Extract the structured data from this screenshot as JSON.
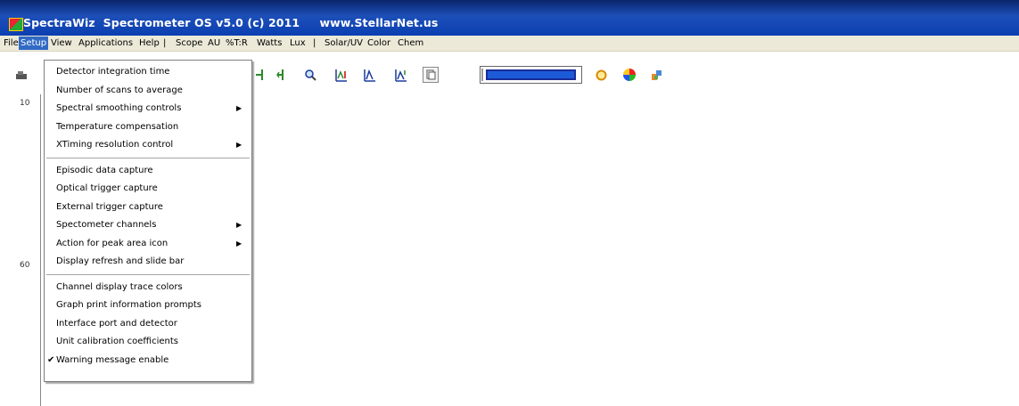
{
  "window": {
    "title": "SpectraWiz  Spectrometer OS v5.0 (c) 2011     www.StellarNet.us"
  },
  "menubar": {
    "items": [
      {
        "label": "File"
      },
      {
        "label": "Setup"
      },
      {
        "label": "View"
      },
      {
        "label": "Applications"
      },
      {
        "label": "Help"
      },
      {
        "label": "|"
      },
      {
        "label": "Scope"
      },
      {
        "label": "AU"
      },
      {
        "label": "%T:R"
      },
      {
        "label": "Watts"
      },
      {
        "label": "Lux"
      },
      {
        "label": "|"
      },
      {
        "label": "Solar/UV"
      },
      {
        "label": "Color"
      },
      {
        "label": "Chem"
      }
    ]
  },
  "toolbar": {
    "icons": [
      "scope-icon",
      "cursor-left-icon",
      "cursor-right-icon",
      "zoom-icon",
      "autoscale-icon",
      "peak-icon",
      "peak-area-icon",
      "copy-icon",
      "color-swatch",
      "circle-icon",
      "color-wheel-icon",
      "paint-icon"
    ],
    "trace_color": "#1c5ad8"
  },
  "yaxis": {
    "ticks": [
      "10",
      "60"
    ]
  },
  "setup_menu": {
    "groups": [
      [
        {
          "label": "Detector integration time",
          "submenu": false,
          "checked": false
        },
        {
          "label": "Number of scans to average",
          "submenu": false,
          "checked": false
        },
        {
          "label": "Spectral smoothing controls",
          "submenu": true,
          "checked": false
        },
        {
          "label": "Temperature compensation",
          "submenu": false,
          "checked": false
        },
        {
          "label": "XTiming resolution control",
          "submenu": true,
          "checked": false
        }
      ],
      [
        {
          "label": "Episodic data capture",
          "submenu": false,
          "checked": false
        },
        {
          "label": "Optical trigger capture",
          "submenu": false,
          "checked": false
        },
        {
          "label": "External trigger capture",
          "submenu": false,
          "checked": false
        },
        {
          "label": "Spectometer channels",
          "submenu": true,
          "checked": false
        },
        {
          "label": "Action for peak area icon",
          "submenu": true,
          "checked": false
        },
        {
          "label": "Display refresh and slide bar",
          "submenu": false,
          "checked": false
        }
      ],
      [
        {
          "label": "Channel display trace colors",
          "submenu": false,
          "checked": false
        },
        {
          "label": "Graph print information prompts",
          "submenu": false,
          "checked": false
        },
        {
          "label": "Interface port and detector",
          "submenu": false,
          "checked": false
        },
        {
          "label": "Unit calibration coefficients",
          "submenu": false,
          "checked": false
        },
        {
          "label": "Warning message enable",
          "submenu": false,
          "checked": true
        }
      ]
    ],
    "arrow_glyph": "▶",
    "check_glyph": "✔"
  },
  "colors": {
    "titlebar": "#0b3fb1",
    "menu_highlight": "#316ac5",
    "menubar_bg": "#ece9d8"
  }
}
